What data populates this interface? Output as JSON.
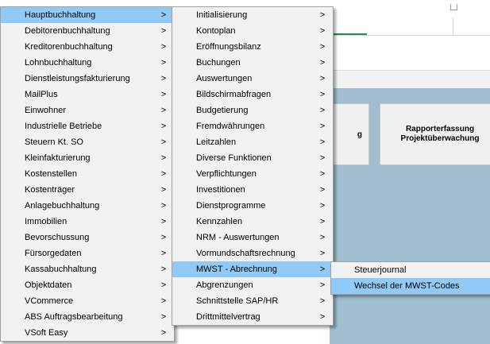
{
  "menu_main": {
    "items": [
      {
        "label": "Hauptbuchhaltung",
        "has_submenu": true,
        "highlighted": true
      },
      {
        "label": "Debitorenbuchhaltung",
        "has_submenu": true
      },
      {
        "label": "Kreditorenbuchhaltung",
        "has_submenu": true
      },
      {
        "label": "Lohnbuchhaltung",
        "has_submenu": true
      },
      {
        "label": "Dienstleistungsfakturierung",
        "has_submenu": true
      },
      {
        "label": "MailPlus",
        "has_submenu": true
      },
      {
        "label": "Einwohner",
        "has_submenu": true
      },
      {
        "label": "Industrielle Betriebe",
        "has_submenu": true
      },
      {
        "label": "Steuern Kt. SO",
        "has_submenu": true
      },
      {
        "label": "Kleinfakturierung",
        "has_submenu": true
      },
      {
        "label": "Kostenstellen",
        "has_submenu": true
      },
      {
        "label": "Kostenträger",
        "has_submenu": true
      },
      {
        "label": "Anlagebuchhaltung",
        "has_submenu": true
      },
      {
        "label": "Immobilien",
        "has_submenu": true
      },
      {
        "label": "Bevorschussung",
        "has_submenu": true
      },
      {
        "label": "Fürsorgedaten",
        "has_submenu": true
      },
      {
        "label": "Kassabuchhaltung",
        "has_submenu": true
      },
      {
        "label": "Objektdaten",
        "has_submenu": true
      },
      {
        "label": "VCommerce",
        "has_submenu": true
      },
      {
        "label": "ABS Auftragsbearbeitung",
        "has_submenu": true
      },
      {
        "label": "VSoft Easy",
        "has_submenu": true
      }
    ]
  },
  "menu_sub": {
    "items": [
      {
        "label": "Initialisierung",
        "has_submenu": true
      },
      {
        "label": "Kontoplan",
        "has_submenu": true
      },
      {
        "label": "Eröffnungsbilanz",
        "has_submenu": true
      },
      {
        "label": "Buchungen",
        "has_submenu": true
      },
      {
        "label": "Auswertungen",
        "has_submenu": true
      },
      {
        "label": "Bildschirmabfragen",
        "has_submenu": true
      },
      {
        "label": "Budgetierung",
        "has_submenu": true
      },
      {
        "label": "Fremdwährungen",
        "has_submenu": true
      },
      {
        "label": "Leitzahlen",
        "has_submenu": true
      },
      {
        "label": "Diverse Funktionen",
        "has_submenu": true
      },
      {
        "label": "Verpflichtungen",
        "has_submenu": true
      },
      {
        "label": "Investitionen",
        "has_submenu": true
      },
      {
        "label": "Dienstprogramme",
        "has_submenu": true
      },
      {
        "label": "Kennzahlen",
        "has_submenu": true
      },
      {
        "label": "NRM - Auswertungen",
        "has_submenu": true
      },
      {
        "label": "Vormundschaftsrechnung",
        "has_submenu": true
      },
      {
        "label": "MWST - Abrechnung",
        "has_submenu": true,
        "highlighted": true
      },
      {
        "label": "Abgrenzungen",
        "has_submenu": true
      },
      {
        "label": "Schnittstelle SAP/HR",
        "has_submenu": true
      },
      {
        "label": "Drittmittelvertrag",
        "has_submenu": true
      }
    ]
  },
  "menu_mwst": {
    "items": [
      {
        "label": "Steuerjournal",
        "has_submenu": false
      },
      {
        "label": "Wechsel der MWST-Codes",
        "has_submenu": false,
        "highlighted": true
      }
    ]
  },
  "background": {
    "left_button_label": "g",
    "right_button_line1": "Rapporterfassung",
    "right_button_line2": "Projektüberwachung"
  },
  "glyphs": {
    "submenu_arrow": ">"
  },
  "colors": {
    "menu_bg": "#f2f2f2",
    "highlight": "#91c9f7",
    "work_area": "#9fbfd0",
    "tab_accent": "#2e8a4a"
  }
}
